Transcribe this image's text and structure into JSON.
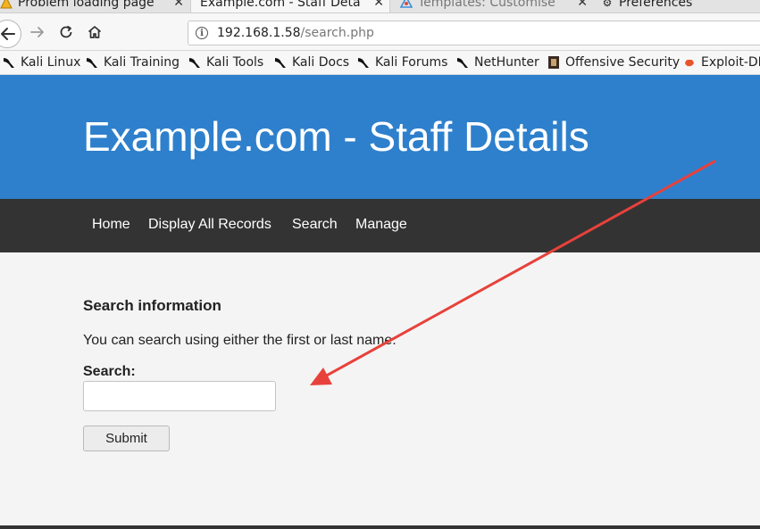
{
  "browser": {
    "tabs": [
      {
        "title": "Problem loading page",
        "icon": "warning-icon",
        "active": false
      },
      {
        "title": "Example.com - Staff Details",
        "icon": "none",
        "active": true
      },
      {
        "title": "Templates: Customise (P",
        "icon": "template-icon",
        "active": false
      },
      {
        "title": "Preferences",
        "icon": "gear-icon",
        "active": false
      }
    ],
    "url": {
      "host": "192.168.1.58",
      "path": "/search.php"
    },
    "bookmarks": [
      {
        "label": "Kali Linux",
        "icon": "kali-dragon-icon"
      },
      {
        "label": "Kali Training",
        "icon": "kali-dragon-icon"
      },
      {
        "label": "Kali Tools",
        "icon": "kali-dragon-icon"
      },
      {
        "label": "Kali Docs",
        "icon": "kali-dragon-icon"
      },
      {
        "label": "Kali Forums",
        "icon": "kali-dragon-icon"
      },
      {
        "label": "NetHunter",
        "icon": "kali-dragon-icon"
      },
      {
        "label": "Offensive Security",
        "icon": "offsec-icon"
      },
      {
        "label": "Exploit-DB",
        "icon": "exploit-db-icon"
      }
    ]
  },
  "page": {
    "site_title": "Example.com - Staff Details",
    "nav": [
      "Home",
      "Display All Records",
      "Search",
      "Manage"
    ],
    "section_title": "Search information",
    "description": "You can search using either the first or last name.",
    "search_label": "Search:",
    "search_value": "",
    "submit_label": "Submit"
  },
  "colors": {
    "header_bg": "#2e80cc",
    "nav_bg": "#333333",
    "annotation_arrow": "#e8413b"
  }
}
